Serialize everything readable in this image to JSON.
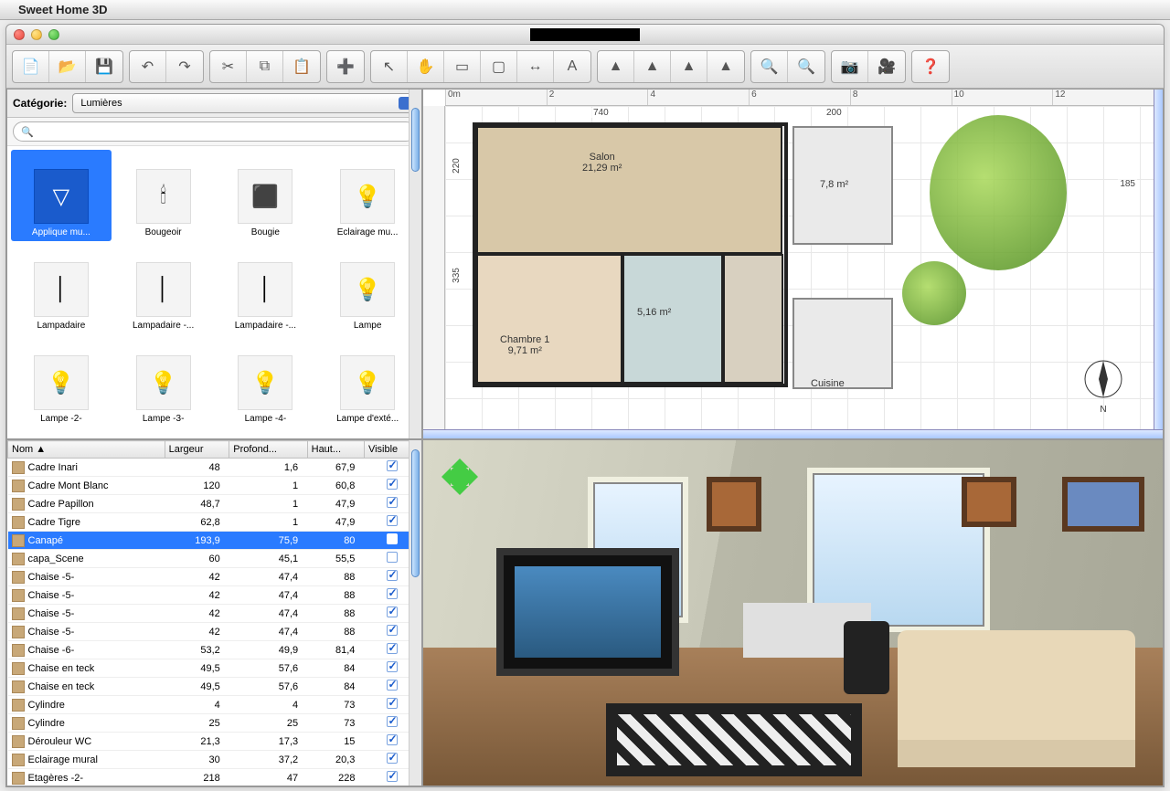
{
  "menubar": {
    "app_title": "Sweet Home 3D"
  },
  "toolbar_groups": [
    [
      "new",
      "open",
      "save"
    ],
    [
      "undo",
      "redo"
    ],
    [
      "cut",
      "copy",
      "paste"
    ],
    [
      "add-furniture"
    ],
    [
      "select",
      "pan",
      "wall",
      "room",
      "dimension",
      "text"
    ],
    [
      "3d-aerial",
      "3d-virtual",
      "3d-top",
      "3d-modify"
    ],
    [
      "zoom-in",
      "zoom-out"
    ],
    [
      "photo",
      "video"
    ],
    [
      "help"
    ]
  ],
  "catalog": {
    "label": "Catégorie:",
    "selected_category": "Lumières",
    "search_placeholder": "",
    "selected_index": 0,
    "items": [
      {
        "name": "Applique mu...",
        "glyph": "▽"
      },
      {
        "name": "Bougeoir",
        "glyph": "🕯"
      },
      {
        "name": "Bougie",
        "glyph": "⬛"
      },
      {
        "name": "Eclairage mu...",
        "glyph": "💡"
      },
      {
        "name": "Lampadaire",
        "glyph": "│"
      },
      {
        "name": "Lampadaire -...",
        "glyph": "│"
      },
      {
        "name": "Lampadaire -...",
        "glyph": "│"
      },
      {
        "name": "Lampe",
        "glyph": "💡"
      },
      {
        "name": "Lampe -2-",
        "glyph": "💡"
      },
      {
        "name": "Lampe -3-",
        "glyph": "💡"
      },
      {
        "name": "Lampe -4-",
        "glyph": "💡"
      },
      {
        "name": "Lampe d'exté...",
        "glyph": "💡"
      }
    ]
  },
  "furniture_table": {
    "columns": [
      "Nom ▲",
      "Largeur",
      "Profond...",
      "Haut...",
      "Visible"
    ],
    "selected_index": 4,
    "rows": [
      {
        "name": "Cadre Inari",
        "w": "48",
        "d": "1,6",
        "h": "67,9",
        "v": true
      },
      {
        "name": "Cadre Mont Blanc",
        "w": "120",
        "d": "1",
        "h": "60,8",
        "v": true
      },
      {
        "name": "Cadre Papillon",
        "w": "48,7",
        "d": "1",
        "h": "47,9",
        "v": true
      },
      {
        "name": "Cadre Tigre",
        "w": "62,8",
        "d": "1",
        "h": "47,9",
        "v": true
      },
      {
        "name": "Canapé",
        "w": "193,9",
        "d": "75,9",
        "h": "80",
        "v": true
      },
      {
        "name": "capa_Scene",
        "w": "60",
        "d": "45,1",
        "h": "55,5",
        "v": false
      },
      {
        "name": "Chaise -5-",
        "w": "42",
        "d": "47,4",
        "h": "88",
        "v": true
      },
      {
        "name": "Chaise -5-",
        "w": "42",
        "d": "47,4",
        "h": "88",
        "v": true
      },
      {
        "name": "Chaise -5-",
        "w": "42",
        "d": "47,4",
        "h": "88",
        "v": true
      },
      {
        "name": "Chaise -5-",
        "w": "42",
        "d": "47,4",
        "h": "88",
        "v": true
      },
      {
        "name": "Chaise -6-",
        "w": "53,2",
        "d": "49,9",
        "h": "81,4",
        "v": true
      },
      {
        "name": "Chaise en teck",
        "w": "49,5",
        "d": "57,6",
        "h": "84",
        "v": true
      },
      {
        "name": "Chaise en teck",
        "w": "49,5",
        "d": "57,6",
        "h": "84",
        "v": true
      },
      {
        "name": "Cylindre",
        "w": "4",
        "d": "4",
        "h": "73",
        "v": true
      },
      {
        "name": "Cylindre",
        "w": "25",
        "d": "25",
        "h": "73",
        "v": true
      },
      {
        "name": "Dérouleur WC",
        "w": "21,3",
        "d": "17,3",
        "h": "15",
        "v": true
      },
      {
        "name": "Eclairage mural",
        "w": "30",
        "d": "37,2",
        "h": "20,3",
        "v": true
      },
      {
        "name": "Etagères -2-",
        "w": "218",
        "d": "47",
        "h": "228",
        "v": true
      }
    ]
  },
  "plan": {
    "ruler_ticks": [
      "0m",
      "2",
      "4",
      "6",
      "8",
      "10",
      "12"
    ],
    "dims": {
      "main_w": "740",
      "terrace_w": "200",
      "tree_h": "185",
      "h1": "220",
      "h2": "335"
    },
    "rooms": {
      "salon": {
        "name": "Salon",
        "area": "21,29 m²"
      },
      "chambre": {
        "name": "Chambre 1",
        "area": "9,71 m²"
      },
      "sdb": {
        "area": "5,16 m²"
      },
      "terrace": {
        "area": "7,8 m²"
      },
      "cuisine": {
        "name": "Cuisine"
      }
    },
    "compass": "N"
  }
}
